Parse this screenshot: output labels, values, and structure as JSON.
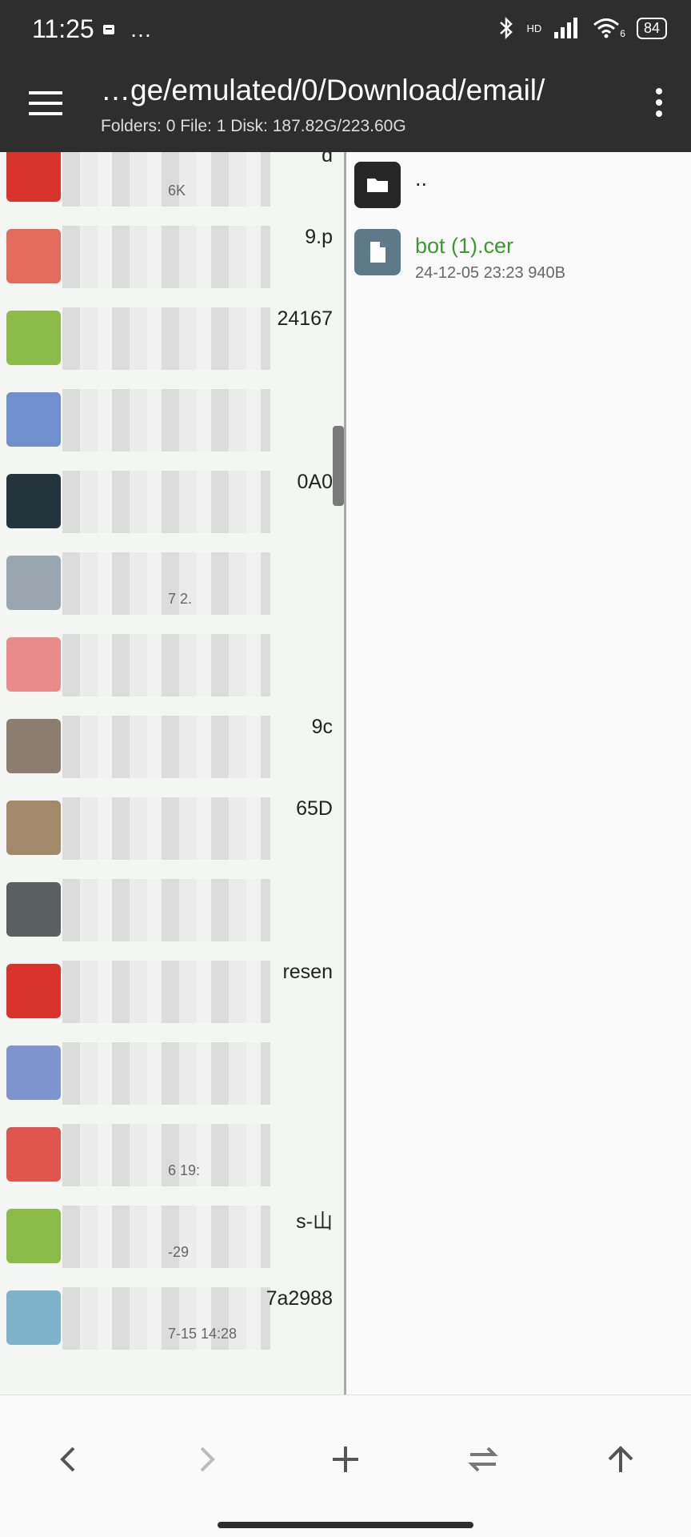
{
  "status_bar": {
    "time": "11:25",
    "more_glyph": "…",
    "network_label": "HD",
    "signal_label": "6",
    "battery": "84"
  },
  "toolbar": {
    "path": "…ge/emulated/0/Download/email/",
    "stats": "Folders: 0  File: 1  Disk: 187.82G/223.60G"
  },
  "left_pane": {
    "rows": [
      {
        "name": "d",
        "meta": "6K",
        "thumb_color": "#d9342b"
      },
      {
        "name": "9.p",
        "meta": "",
        "thumb_color": "#e26b5e"
      },
      {
        "name": "24167",
        "meta": "",
        "thumb_color": "#8dbb4a"
      },
      {
        "name": "",
        "meta": "",
        "thumb_color": "#6f8fcf"
      },
      {
        "name": "0A0",
        "meta": "",
        "thumb_color": "#24343c"
      },
      {
        "name": "",
        "meta": "7  2.",
        "thumb_color": "#9aa7b0"
      },
      {
        "name": "",
        "meta": "",
        "thumb_color": "#e98b8b"
      },
      {
        "name": "9c",
        "meta": "",
        "thumb_color": "#8b7d70"
      },
      {
        "name": "65D",
        "meta": "",
        "thumb_color": "#a08a6a"
      },
      {
        "name": "",
        "meta": "",
        "thumb_color": "#5a5f60"
      },
      {
        "name": "resen",
        "meta": "",
        "thumb_color": "#d9342b"
      },
      {
        "name": "",
        "meta": "",
        "thumb_color": "#7d94cf"
      },
      {
        "name": "",
        "meta": "6 19:",
        "thumb_color": "#e0554d"
      },
      {
        "name": "s-山",
        "meta": "-29",
        "thumb_color": "#8dbb4a"
      },
      {
        "name": "7a2988",
        "meta": "7-15 14:28",
        "thumb_color": "#7fb3cc"
      }
    ]
  },
  "right_pane": {
    "parent_label": "..",
    "file": {
      "name": "bot (1).cer",
      "meta": "24-12-05 23:23  940B"
    }
  },
  "colors": {
    "bar_background": "#2e2e2e",
    "file_name_green": "#3a9a2f",
    "doc_icon_bg": "#5e7988"
  },
  "icons": {
    "menu": "hamburger-icon",
    "more": "more-vertical-icon",
    "back": "chevron-left-icon",
    "forward": "chevron-right-icon",
    "add": "plus-icon",
    "swap": "swap-arrows-icon",
    "up": "arrow-up-icon"
  }
}
